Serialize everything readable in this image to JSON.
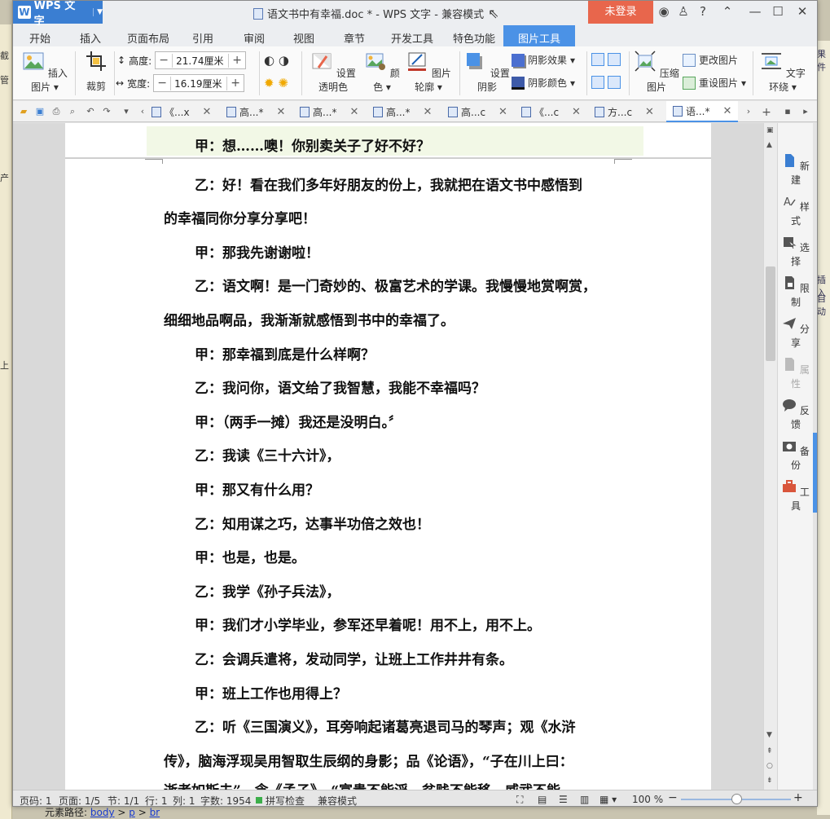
{
  "titlebar": {
    "app_name": "WPS 文字",
    "doc_title": "语文书中有幸福.doc * - WPS 文字 - 兼容模式",
    "login": "未登录"
  },
  "ribbon_tabs": [
    "开始",
    "插入",
    "页面布局",
    "引用",
    "审阅",
    "视图",
    "章节",
    "开发工具",
    "特色功能",
    "图片工具"
  ],
  "ribbon": {
    "insert_picture": "插入图片",
    "crop": "裁剪",
    "height_label": "高度:",
    "height_value": "21.74厘米",
    "width_label": "宽度:",
    "width_value": "16.19厘米",
    "set_transparent": "设置透明色",
    "color": "颜色",
    "picture_outline": "图片轮廓",
    "set_shadow": "设置阴影",
    "shadow_effect": "阴影效果",
    "shadow_color": "阴影颜色",
    "compress_picture": "压缩图片",
    "change_picture": "更改图片",
    "reset_picture": "重设图片",
    "text_wrap": "文字环绕"
  },
  "doc_tabs": [
    "《...x",
    "高...*",
    "高...*",
    "高...*",
    "高...c",
    "《...c",
    "方...c",
    "语...*"
  ],
  "document": {
    "lines": [
      "甲：想……噢！你别卖关子了好不好？",
      "乙：好！看在我们多年好朋友的份上，我就把在语文书中感悟到",
      "的幸福同你分享分享吧！",
      "甲：那我先谢谢啦！",
      "乙：语文啊！是一门奇妙的、极富艺术的学课。我慢慢地赏啊赏，",
      "细细地品啊品，我渐渐就感悟到书中的幸福了。",
      "甲：那幸福到底是什么样啊？",
      "乙：我问你，语文给了我智慧，我能不幸福吗？",
      "甲：（两手一摊）我还是没明白。〞",
      "乙：我读《三十六计》，",
      "甲：那又有什么用？",
      "乙：知用谋之巧，达事半功倍之效也！",
      "甲：也是，也是。",
      "乙：我学《孙子兵法》，",
      "甲：我们才小学毕业，参军还早着呢！用不上，用不上。",
      "乙：会调兵遣将，发动同学，让班上工作井井有条。",
      "甲：班上工作也用得上？",
      "乙：听《三国演义》，耳旁响起诸葛亮退司马的琴声；观《水浒",
      "传》，脑海浮现吴用智取生辰纲的身影；品《论语》，“子在川上曰：",
      "逝者如斯夫”，念《孟子》，“富贵不能淫，贫贱不能移，威武不能"
    ]
  },
  "taskpane": [
    "新建",
    "样式",
    "选择",
    "限制",
    "分享",
    "属性",
    "反馈",
    "备份",
    "工具"
  ],
  "statusbar": {
    "page_no": "页码: 1",
    "pages": "页面: 1/5",
    "section": "节: 1/1",
    "row": "行: 1",
    "col": "列: 1",
    "words": "字数: 1954",
    "spell": "拼写检查",
    "compat": "兼容模式",
    "zoom": "100 %",
    "zoom_level": 0.5
  },
  "background": {
    "left_chars": [
      "截",
      "管",
      "产",
      "上"
    ],
    "right_chars": [
      "插入",
      "自动",
      "果件"
    ],
    "bottom_text": "元素路径:",
    "bottom_links": [
      "body",
      "p",
      "br"
    ]
  },
  "colors": {
    "accent": "#4b92e6",
    "login": "#e8664c"
  }
}
